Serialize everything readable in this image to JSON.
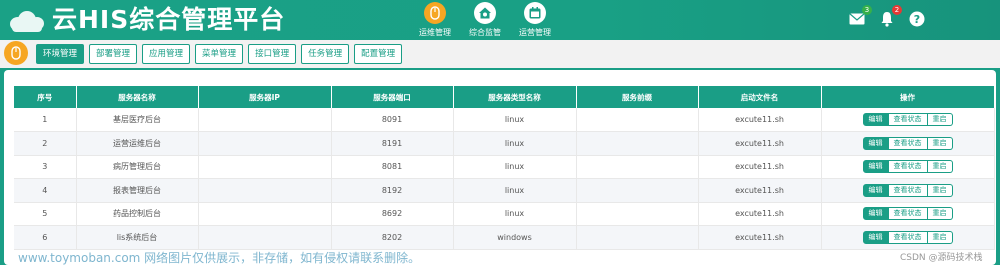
{
  "app": {
    "title": "云HIS综合管理平台"
  },
  "topnav": [
    {
      "label": "运维管理",
      "icon": "mouse-icon",
      "active": true
    },
    {
      "label": "综合监管",
      "icon": "home-shield-icon",
      "active": false
    },
    {
      "label": "运营管理",
      "icon": "calendar-icon",
      "active": false
    }
  ],
  "header_icons": {
    "mail": {
      "icon": "mail-icon",
      "badge": "3",
      "badge_color": "#36b04a"
    },
    "bell": {
      "icon": "bell-icon",
      "badge": "2",
      "badge_color": "#e53935"
    },
    "help": {
      "icon": "help-icon"
    }
  },
  "tabs": [
    "环境管理",
    "部署管理",
    "应用管理",
    "菜单管理",
    "接口管理",
    "任务管理",
    "配置管理"
  ],
  "table": {
    "columns": [
      "序号",
      "服务器名称",
      "服务器IP",
      "服务器端口",
      "服务器类型名称",
      "服务前缀",
      "启动文件名",
      "操作"
    ],
    "rows": [
      [
        "1",
        "基层医疗后台",
        "",
        "8091",
        "linux",
        "",
        "excute11.sh"
      ],
      [
        "2",
        "运营运维后台",
        "",
        "8191",
        "linux",
        "",
        "excute11.sh"
      ],
      [
        "3",
        "病历管理后台",
        "",
        "8081",
        "linux",
        "",
        "excute11.sh"
      ],
      [
        "4",
        "报表管理后台",
        "",
        "8192",
        "linux",
        "",
        "excute11.sh"
      ],
      [
        "5",
        "药品控制后台",
        "",
        "8692",
        "linux",
        "",
        "excute11.sh"
      ],
      [
        "6",
        "lis系统后台",
        "",
        "8202",
        "windows",
        "",
        "excute11.sh"
      ]
    ],
    "actions": [
      "编辑",
      "查看状态",
      "重启"
    ]
  },
  "watermark": "www.toymoban.com 网络图片仅供展示，非存储，如有侵权请联系删除。",
  "credit": "CSDN @源码技术栈",
  "colors": {
    "brand": "#1a9e86",
    "accent": "#f6a623"
  }
}
